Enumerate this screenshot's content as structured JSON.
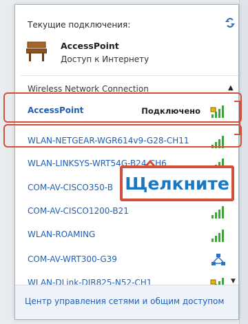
{
  "current_connections": {
    "label": "Текущие подключения:",
    "network_name": "AccessPoint",
    "network_status": "Доступ к Интернету"
  },
  "section_title": "Wireless Network Connection",
  "networks": [
    {
      "name": "AccessPoint",
      "status": "Подключено",
      "secured": true
    },
    {
      "name": "WLAN-NETGEAR-WGR614v9-G28-CH11",
      "status": "",
      "secured": false
    },
    {
      "name": "WLAN-LINKSYS-WRT54G-B24-CH6",
      "status": "",
      "secured": false
    },
    {
      "name": "COM-AV-CISCO350-B",
      "status": "",
      "secured": false
    },
    {
      "name": "COM-AV-CISCO1200-B21",
      "status": "",
      "secured": false
    },
    {
      "name": "WLAN-ROAMING",
      "status": "",
      "secured": false
    },
    {
      "name": "COM-AV-WRT300-G39",
      "status": "",
      "secured": false
    },
    {
      "name": "WLAN-DLink-DIR825-N52-CH1",
      "status": "",
      "secured": true
    }
  ],
  "callout": "Щелкните",
  "footer_link": "Центр управления сетями и общим доступом",
  "colors": {
    "link_blue": "#1f5fb5",
    "highlight_red": "#d2503a",
    "callout_text": "#1a78c2",
    "signal_green": "#3fa33a"
  },
  "icons": {
    "refresh": "refresh-icon",
    "current_network": "bench-network-icon",
    "signal": "signal-bars-icon",
    "secured_signal": "secured-signal-icon",
    "adhoc": "adhoc-network-icon",
    "collapse": "chevron-up-icon"
  }
}
